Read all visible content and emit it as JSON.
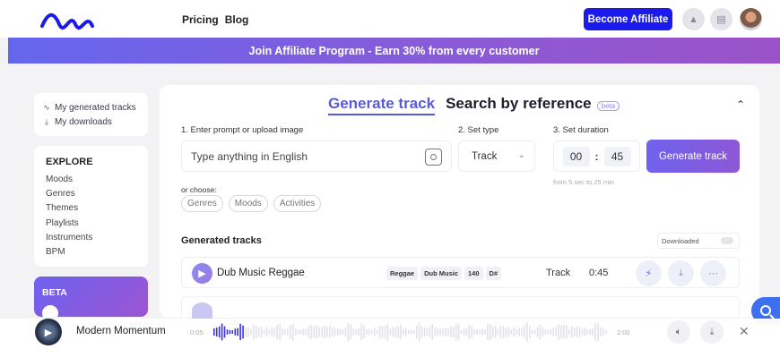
{
  "header": {
    "nav": [
      "Pricing",
      "Blog"
    ],
    "affiliate_button": "Become Affiliate",
    "icons": [
      "bell-icon",
      "document-icon"
    ]
  },
  "banner": {
    "text": "Join Affiliate Program - Earn 30% from every customer"
  },
  "sidebar": {
    "top_items": [
      {
        "label": "My generated tracks",
        "icon": "waveform-icon"
      },
      {
        "label": "My downloads",
        "icon": "download-icon"
      }
    ],
    "explore_title": "EXPLORE",
    "explore_items": [
      "Moods",
      "Genres",
      "Themes",
      "Playlists",
      "Instruments",
      "BPM"
    ],
    "beta_label": "BETA"
  },
  "generator": {
    "tab_active": "Generate track",
    "tab_other": "Search by reference",
    "tab_other_badge": "beta",
    "label_prompt": "1. Enter prompt or upload image",
    "label_type": "2. Set type",
    "label_duration": "3. Set duration",
    "prompt_placeholder": "Type anything in English",
    "type_value": "Track",
    "duration_min": "00",
    "duration_sep": ":",
    "duration_sec": "45",
    "duration_hint": "from 5 sec to 25 min",
    "generate_button": "Generate track",
    "or_choose": "or choose:",
    "chips": [
      "Genres",
      "Moods",
      "Activities"
    ]
  },
  "generated": {
    "title": "Generated tracks",
    "filter_label": "Downloaded",
    "tracks": [
      {
        "name": "Dub Music Reggae",
        "tags": [
          "Reggae",
          "Dub Music",
          "140",
          "D#"
        ],
        "type": "Track",
        "duration": "0:45"
      }
    ]
  },
  "player": {
    "title": "Modern Momentum",
    "time_start": "0:05",
    "time_end": "2:00",
    "progress": 0.04
  },
  "colors": {
    "accent": "#5a5ad8",
    "primary_button": "#1a1aed",
    "gradient_start": "#6f62ee",
    "gradient_end": "#8d57d6"
  }
}
